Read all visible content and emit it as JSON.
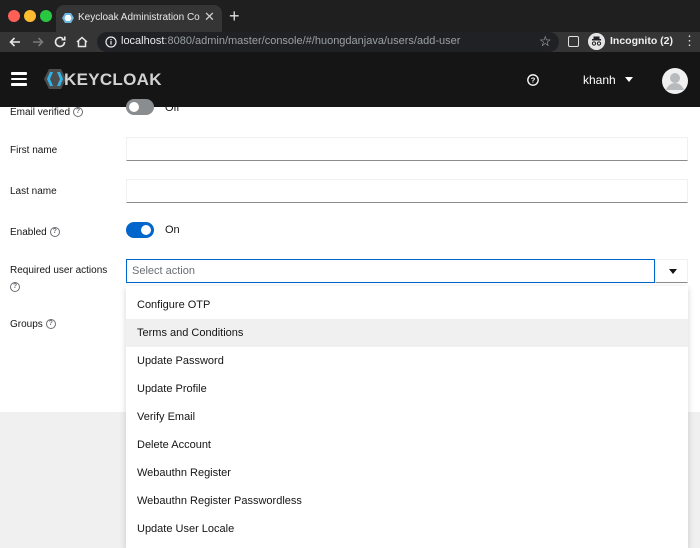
{
  "browser": {
    "tab_title": "Keycloak Administration Console",
    "url_host": "localhost",
    "url_rest": ":8080/admin/master/console/#/huongdanjava/users/add-user",
    "profile_label": "Incognito (2)"
  },
  "masthead": {
    "logo_text": "KEYCLOAK",
    "user_name": "khanh"
  },
  "form": {
    "email_verified_label": "Email verified",
    "email_verified_state": "Off",
    "first_name_label": "First name",
    "first_name_value": "",
    "last_name_label": "Last name",
    "last_name_value": "",
    "enabled_label": "Enabled",
    "enabled_state": "On",
    "required_actions_label": "Required user actions",
    "required_actions_placeholder": "Select action",
    "groups_label": "Groups"
  },
  "dropdown": {
    "items": [
      "Configure OTP",
      "Terms and Conditions",
      "Update Password",
      "Update Profile",
      "Verify Email",
      "Delete Account",
      "Webauthn Register",
      "Webauthn Register Passwordless",
      "Update User Locale"
    ],
    "hovered_index": 1
  },
  "colors": {
    "masthead_bg": "#151515",
    "switch_on": "#0066cc",
    "switch_off": "#8a8d90",
    "focus_border": "#0066cc"
  }
}
